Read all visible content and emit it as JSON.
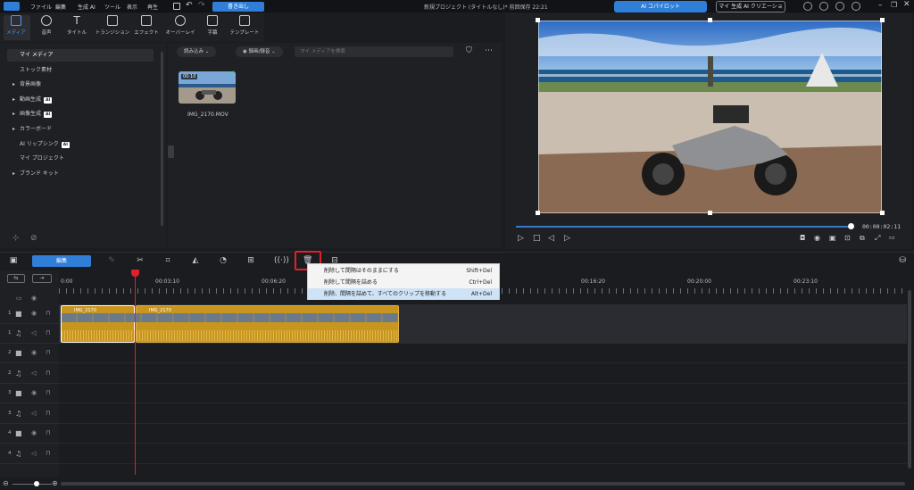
{
  "menu": {
    "items": [
      "ファイル",
      "編集",
      "生成 AI",
      "ツール",
      "表示",
      "再生"
    ],
    "export": "書き出し"
  },
  "title": "新規プロジェクト (タイトルなし)* 前回保存 22:21",
  "copilot": "AI コパイロット",
  "ai_creation": "マイ 生成 AI クリエーション",
  "tabs": [
    "メディア",
    "音声",
    "タイトル",
    "トランジション",
    "エフェクト",
    "オーバーレイ",
    "字幕",
    "テンプレート"
  ],
  "sidebar": {
    "items": [
      {
        "label": "マイ メディア",
        "expander": "",
        "ai": ""
      },
      {
        "label": "ストック素材",
        "expander": "",
        "ai": ""
      },
      {
        "label": "背景画像",
        "expander": "▸",
        "ai": ""
      },
      {
        "label": "動画生成",
        "expander": "▸",
        "ai": "AI"
      },
      {
        "label": "画像生成",
        "expander": "▸",
        "ai": "AI"
      },
      {
        "label": "カラーボード",
        "expander": "▸",
        "ai": ""
      },
      {
        "label": "AI リップシンク",
        "expander": "",
        "ai": "AI"
      },
      {
        "label": "マイ プロジェクト",
        "expander": "",
        "ai": ""
      },
      {
        "label": "ブランド キット",
        "expander": "▸",
        "ai": ""
      }
    ]
  },
  "media_toolbar": {
    "import": "読み込み",
    "record": "録画/録音",
    "search_placeholder": "マイ メディアを検索"
  },
  "media_item": {
    "name": "IMG_2170.MOV",
    "duration": "00:10"
  },
  "preview": {
    "timecode": "00:00:02:11"
  },
  "timeline": {
    "edit_label": "編集",
    "ruler": [
      "0:00",
      "00:03:10",
      "00:06:20",
      "00:16:20",
      "00:20:00",
      "00:23:10"
    ],
    "clips": [
      {
        "label": "IMG_2170"
      },
      {
        "label": "IMG_2170"
      }
    ],
    "tracks": [
      {
        "num": "1",
        "icon": "video"
      },
      {
        "num": "1",
        "icon": "audio"
      },
      {
        "num": "2",
        "icon": "video"
      },
      {
        "num": "2",
        "icon": "audio"
      },
      {
        "num": "3",
        "icon": "video"
      },
      {
        "num": "3",
        "icon": "audio"
      },
      {
        "num": "4",
        "icon": "video"
      },
      {
        "num": "4",
        "icon": "audio"
      }
    ]
  },
  "context_menu": [
    {
      "label": "削除して間隔はそのままにする",
      "shortcut": "Shift+Del"
    },
    {
      "label": "削除して間隔を詰める",
      "shortcut": "Ctrl+Del"
    },
    {
      "label": "削除、間隔を詰めて、すべてのクリップを移動する",
      "shortcut": "Alt+Del"
    }
  ],
  "colors": {
    "accent": "#2f7fd8",
    "highlight": "#e0202a",
    "clip": "#c8951e"
  }
}
